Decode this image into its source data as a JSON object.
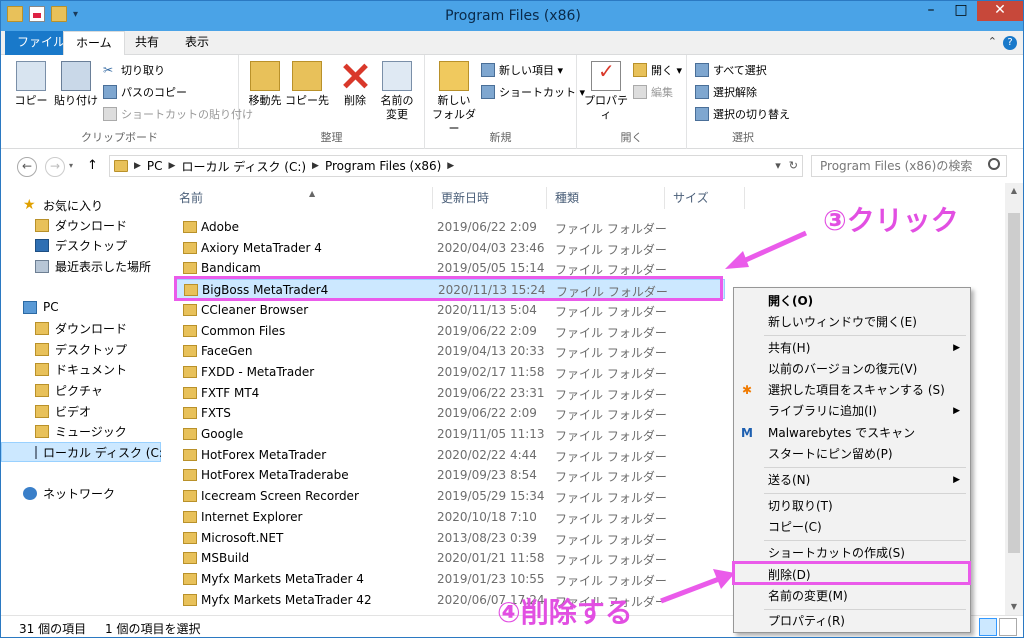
{
  "window": {
    "title": "Program Files (x86)"
  },
  "ribbon": {
    "tabs": {
      "file": "ファイル",
      "home": "ホーム",
      "share": "共有",
      "view": "表示"
    },
    "clipboard": {
      "copy": "コピー",
      "paste": "貼り付け",
      "cut": "切り取り",
      "copy_path": "パスのコピー",
      "paste_shortcut": "ショートカットの貼り付け",
      "label": "クリップボード"
    },
    "organize": {
      "move_to": "移動先",
      "copy_to": "コピー先",
      "delete": "削除",
      "rename_1": "名前の",
      "rename_2": "変更",
      "label": "整理"
    },
    "new": {
      "new_folder_1": "新しい",
      "new_folder_2": "フォルダー",
      "new_item": "新しい項目 ▾",
      "easy_access": "ショートカット ▾",
      "label": "新規"
    },
    "open": {
      "properties": "プロパティ",
      "open": "開く ▾",
      "edit": "編集",
      "label": "開く"
    },
    "select": {
      "select_all": "すべて選択",
      "select_none": "選択解除",
      "invert": "選択の切り替え",
      "label": "選択"
    }
  },
  "address": {
    "back": "←",
    "forward": "→",
    "up": "↑",
    "crumbs": [
      "PC",
      "ローカル ディスク (C:)",
      "Program Files (x86)"
    ],
    "search_placeholder": "Program Files (x86)の検索"
  },
  "nav": {
    "favorites": "お気に入り",
    "fav_items": [
      "ダウンロード",
      "デスクトップ",
      "最近表示した場所"
    ],
    "pc": "PC",
    "pc_items": [
      "ダウンロード",
      "デスクトップ",
      "ドキュメント",
      "ピクチャ",
      "ビデオ",
      "ミュージック",
      "ローカル ディスク (C:)"
    ],
    "network": "ネットワーク"
  },
  "columns": {
    "name": "名前",
    "date": "更新日時",
    "type": "種類",
    "size": "サイズ"
  },
  "files": [
    {
      "name": "Adobe",
      "date": "2019/06/22 2:09",
      "type": "ファイル フォルダー"
    },
    {
      "name": "Axiory MetaTrader 4",
      "date": "2020/04/03 23:46",
      "type": "ファイル フォルダー"
    },
    {
      "name": "Bandicam",
      "date": "2019/05/05 15:14",
      "type": "ファイル フォルダー"
    },
    {
      "name": "BigBoss MetaTrader4",
      "date": "2020/11/13 15:24",
      "type": "ファイル フォルダー"
    },
    {
      "name": "CCleaner Browser",
      "date": "2020/11/13 5:04",
      "type": "ファイル フォルダー"
    },
    {
      "name": "Common Files",
      "date": "2019/06/22 2:09",
      "type": "ファイル フォルダー"
    },
    {
      "name": "FaceGen",
      "date": "2019/04/13 20:33",
      "type": "ファイル フォルダー"
    },
    {
      "name": "FXDD - MetaTrader",
      "date": "2019/02/17 11:58",
      "type": "ファイル フォルダー"
    },
    {
      "name": "FXTF MT4",
      "date": "2019/06/22 23:31",
      "type": "ファイル フォルダー"
    },
    {
      "name": "FXTS",
      "date": "2019/06/22 2:09",
      "type": "ファイル フォルダー"
    },
    {
      "name": "Google",
      "date": "2019/11/05 11:13",
      "type": "ファイル フォルダー"
    },
    {
      "name": "HotForex MetaTrader",
      "date": "2020/02/22 4:44",
      "type": "ファイル フォルダー"
    },
    {
      "name": "HotForex MetaTraderabe",
      "date": "2019/09/23 8:54",
      "type": "ファイル フォルダー"
    },
    {
      "name": "Icecream Screen Recorder",
      "date": "2019/05/29 15:34",
      "type": "ファイル フォルダー"
    },
    {
      "name": "Internet Explorer",
      "date": "2020/10/18 7:10",
      "type": "ファイル フォルダー"
    },
    {
      "name": "Microsoft.NET",
      "date": "2013/08/23 0:39",
      "type": "ファイル フォルダー"
    },
    {
      "name": "MSBuild",
      "date": "2020/01/21 11:58",
      "type": "ファイル フォルダー"
    },
    {
      "name": "Myfx Markets MetaTrader 4",
      "date": "2019/01/23 10:55",
      "type": "ファイル フォルダー"
    },
    {
      "name": "Myfx Markets MetaTrader 42",
      "date": "2020/06/07 17:24",
      "type": "ファイル フォルダー"
    }
  ],
  "status": {
    "count": "31 個の項目",
    "selected": "1 個の項目を選択"
  },
  "context_menu": {
    "open": "開く(O)",
    "open_new_window": "新しいウィンドウで開く(E)",
    "share": "共有(H)",
    "restore": "以前のバージョンの復元(V)",
    "scan": "選択した項目をスキャンする (S)",
    "library": "ライブラリに追加(I)",
    "malwarebytes": "Malwarebytes でスキャン",
    "pin_start": "スタートにピン留め(P)",
    "send_to": "送る(N)",
    "cut": "切り取り(T)",
    "copy": "コピー(C)",
    "create_shortcut": "ショートカットの作成(S)",
    "delete": "削除(D)",
    "rename": "名前の変更(M)",
    "properties": "プロパティ(R)"
  },
  "annotations": {
    "step3": "③クリック",
    "step4": "④削除する"
  },
  "colors": {
    "accent": "#1979ca",
    "annotation": "#ea5bea",
    "selection": "#cce8ff"
  }
}
